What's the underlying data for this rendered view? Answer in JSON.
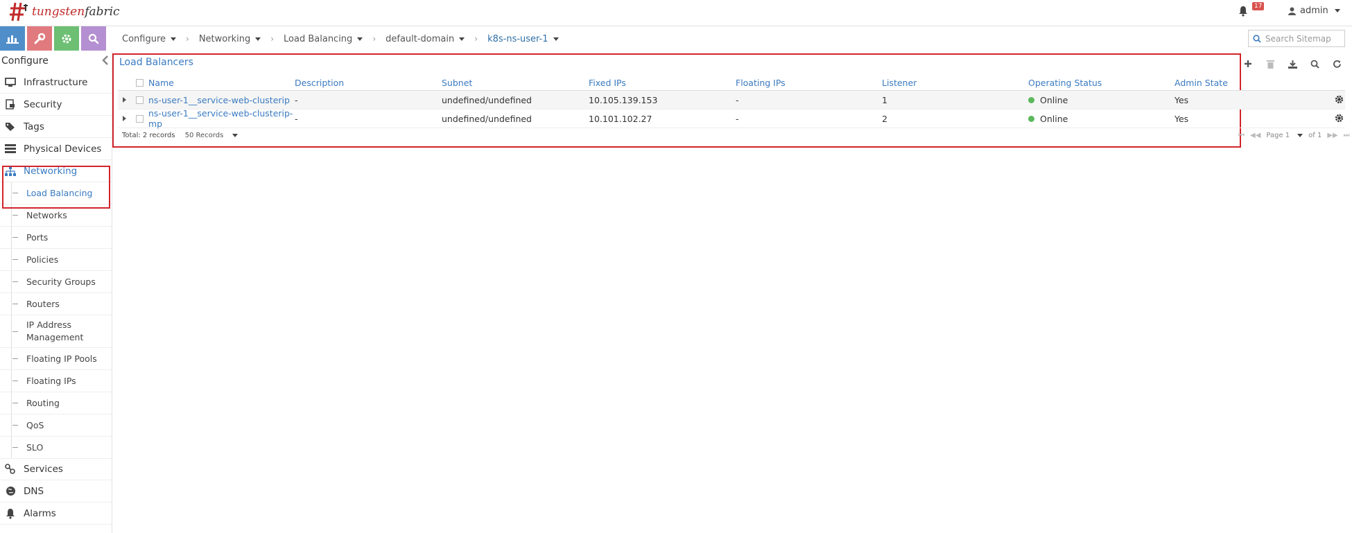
{
  "header": {
    "logo_prefix": "tungsten",
    "logo_suffix": "fabric",
    "notification_count": "17",
    "user": "admin"
  },
  "breadcrumb": [
    {
      "label": "Configure"
    },
    {
      "label": "Networking"
    },
    {
      "label": "Load Balancing"
    },
    {
      "label": "default-domain"
    },
    {
      "label": "k8s-ns-user-1"
    }
  ],
  "search": {
    "placeholder": "Search Sitemap"
  },
  "sidebar": {
    "title": "Configure",
    "items": [
      {
        "label": "Infrastructure",
        "icon": "monitor-icon"
      },
      {
        "label": "Security",
        "icon": "security-icon"
      },
      {
        "label": "Tags",
        "icon": "tags-icon"
      },
      {
        "label": "Physical Devices",
        "icon": "server-icon"
      },
      {
        "label": "Networking",
        "icon": "network-tree-icon"
      }
    ],
    "networking_sub": [
      {
        "label": "Load Balancing"
      },
      {
        "label": "Networks"
      },
      {
        "label": "Ports"
      },
      {
        "label": "Policies"
      },
      {
        "label": "Security Groups"
      },
      {
        "label": "Routers"
      },
      {
        "label": "IP Address Management"
      },
      {
        "label": "Floating IP Pools"
      },
      {
        "label": "Floating IPs"
      },
      {
        "label": "Routing"
      },
      {
        "label": "QoS"
      },
      {
        "label": "SLO"
      }
    ],
    "bottom_items": [
      {
        "label": "Services",
        "icon": "services-icon"
      },
      {
        "label": "DNS",
        "icon": "globe-icon"
      },
      {
        "label": "Alarms",
        "icon": "bell-icon"
      }
    ]
  },
  "panel": {
    "title": "Load Balancers",
    "columns": [
      "Name",
      "Description",
      "Subnet",
      "Fixed IPs",
      "Floating IPs",
      "Listener",
      "Operating Status",
      "Admin State"
    ],
    "rows": [
      {
        "name": "ns-user-1__service-web-clusterip",
        "description": "-",
        "subnet": "undefined/undefined",
        "fixed_ips": "10.105.139.153",
        "floating_ips": "-",
        "listener": "1",
        "status": "Online",
        "admin": "Yes"
      },
      {
        "name": "ns-user-1__service-web-clusterip-mp",
        "description": "-",
        "subnet": "undefined/undefined",
        "fixed_ips": "10.101.102.27",
        "floating_ips": "-",
        "listener": "2",
        "status": "Online",
        "admin": "Yes"
      }
    ],
    "total": "Total: 2 records",
    "page_size": "50 Records",
    "page": "Page 1",
    "of_pages": "of 1"
  },
  "colors": {
    "accent": "#3a7ac0",
    "highlight": "#d2232a",
    "online": "#5cb85c"
  }
}
